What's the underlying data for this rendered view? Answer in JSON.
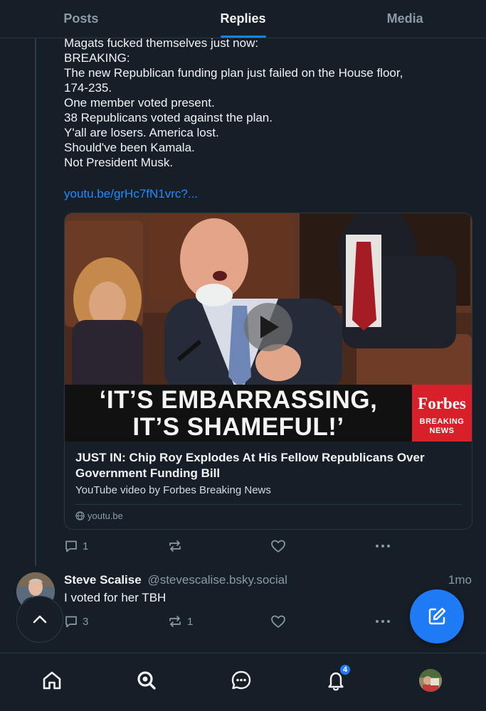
{
  "tabs": [
    {
      "label": "Posts",
      "active": false
    },
    {
      "label": "Replies",
      "active": true
    },
    {
      "label": "Media",
      "active": false
    }
  ],
  "post": {
    "lines": [
      "Magats fucked themselves just now:",
      "BREAKING:",
      "The new Republican funding plan just failed on the House floor,",
      "174-235.",
      "One member voted present.",
      "38 Republicans voted against the plan.",
      "Y'all are losers. America lost.",
      "Should've been Kamala.",
      "Not President Musk."
    ],
    "link": "youtu.be/grHc7fN1vrc?...",
    "embed": {
      "caption_line1": "‘IT’S EMBARRASSING,",
      "caption_line2": "IT’S SHAMEFUL!’",
      "forbes_logo": "Forbes",
      "forbes_sub1": "BREAKING",
      "forbes_sub2": "NEWS",
      "title": "JUST IN: Chip Roy Explodes At His Fellow Republicans Over Government Funding Bill",
      "description": "YouTube video by Forbes Breaking News",
      "domain": "youtu.be",
      "icons": {
        "play": "play-icon",
        "globe": "globe-icon"
      }
    },
    "actions": {
      "reply_count": "1",
      "repost_count": "",
      "like_count": ""
    }
  },
  "reply_post": {
    "author_name": "Steve Scalise",
    "author_handle": "@stevescalise.bsky.social",
    "time": "1mo",
    "text": "I voted for her TBH",
    "actions": {
      "reply_count": "3",
      "repost_count": "1",
      "like_count": ""
    }
  },
  "icons": {
    "reply": "speech-bubble-icon",
    "repost": "repost-icon",
    "like": "heart-icon",
    "more": "ellipsis-icon",
    "scroll_top": "chevron-up-icon",
    "compose": "compose-icon"
  },
  "bottom_nav": {
    "items": [
      "home",
      "search",
      "chat",
      "notifications",
      "profile"
    ],
    "notification_badge": "4"
  },
  "colors": {
    "background": "#161e27",
    "accent": "#1083fe",
    "link": "#1d8cff",
    "muted": "#8d99a6",
    "forbes_red": "#d8202a"
  }
}
